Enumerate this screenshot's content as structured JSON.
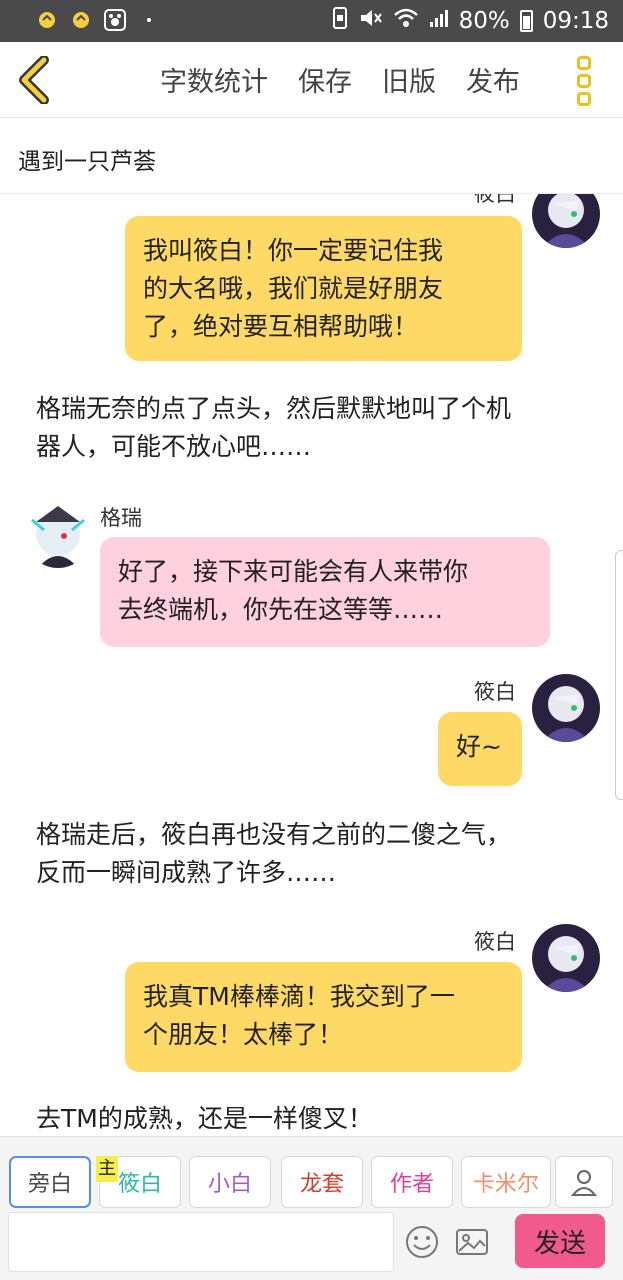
{
  "status_bar": {
    "battery": "80%",
    "time": "09:18"
  },
  "app_bar": {
    "menu": [
      "字数统计",
      "保存",
      "旧版",
      "发布"
    ]
  },
  "story": {
    "title": "遇到一只芦荟"
  },
  "messages": [
    {
      "name": "筱白",
      "text_lines": [
        "我叫筱白！你一定要记住我",
        "的大名哦，我们就是好朋友",
        "了，绝对要互相帮助哦！"
      ]
    },
    {
      "narration_lines": [
        "格瑞无奈的点了点头，然后默默地叫了个机",
        "器人，可能不放心吧……"
      ]
    },
    {
      "name": "格瑞",
      "text_lines": [
        "好了，接下来可能会有人来带你",
        "去终端机，你先在这等等……"
      ]
    },
    {
      "name": "筱白",
      "text_lines": [
        "好~"
      ]
    },
    {
      "narration_lines": [
        "格瑞走后，筱白再也没有之前的二傻之气，",
        "反而一瞬间成熟了许多……"
      ]
    },
    {
      "name": "筱白",
      "text_lines": [
        "我真TM棒棒滴！我交到了一",
        "个朋友！太棒了！"
      ]
    },
    {
      "narration_lines": [
        "去TM的成熟，还是一样傻叉！"
      ]
    }
  ],
  "roles": [
    {
      "label": "旁白",
      "color": "#555555"
    },
    {
      "label": "筱白",
      "color": "#2bb8a8",
      "tag": "主"
    },
    {
      "label": "小白",
      "color": "#a05ad0"
    },
    {
      "label": "龙套",
      "color": "#d04030"
    },
    {
      "label": "作者",
      "color": "#e0409a"
    },
    {
      "label": "卡米尔",
      "color": "#f0906a"
    }
  ],
  "input": {
    "placeholder": "",
    "send_label": "发送"
  },
  "colors": {
    "accent": "#e8c21c",
    "bubble_yellow": "#ffd966",
    "bubble_pink": "#ffd0de",
    "send": "#f05a8c"
  }
}
